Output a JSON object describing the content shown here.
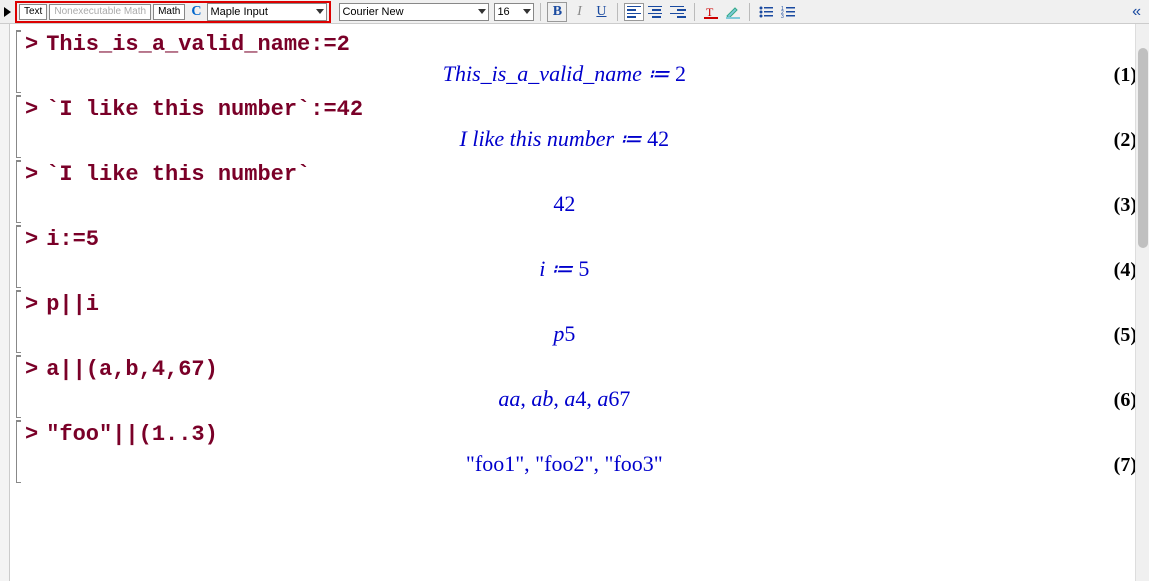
{
  "toolbar": {
    "mode_text": "Text",
    "mode_nonexec": "Nonexecutable Math",
    "mode_math": "Math",
    "style": "Maple Input",
    "font": "Courier New",
    "size": "16"
  },
  "groups": [
    {
      "input": "This_is_a_valid_name:=2",
      "output_html": "This_is_a_valid_name ≔ <span class='upright'>2</span>",
      "label": "(1)"
    },
    {
      "input": "`I like this number`:=42",
      "output_html": "I like this number ≔ <span class='upright'>42</span>",
      "label": "(2)"
    },
    {
      "input": "`I like this number`",
      "output_html": "<span class='upright'>42</span>",
      "label": "(3)"
    },
    {
      "input": "i:=5",
      "output_html": "i ≔ <span class='upright'>5</span>",
      "label": "(4)"
    },
    {
      "input": "p||i",
      "output_html": "p<span class='upright'>5</span>",
      "label": "(5)"
    },
    {
      "input": "a||(a,b,4,67)",
      "output_html": "aa<span class='upright'>, </span>ab<span class='upright'>, </span>a<span class='upright'>4, </span>a<span class='upright'>67</span>",
      "label": "(6)"
    },
    {
      "input": "\"foo\"||(1..3)",
      "output_html": "<span class='upright'>\"foo1\", \"foo2\", \"foo3\"</span>",
      "label": "(7)"
    }
  ]
}
